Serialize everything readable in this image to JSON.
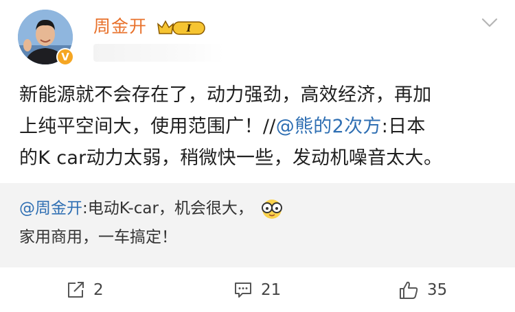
{
  "post": {
    "author": {
      "name": "周金开",
      "verified_mark": "V",
      "vip_level": "I"
    },
    "text_lines": [
      {
        "before": "新能源就不会存在了，动力强劲，高效经济，再加",
        "mention": "",
        "after": ""
      },
      {
        "before": "上纯平空间大，使用范围广！//",
        "mention": "@熊的2次方",
        "after": ":日本"
      },
      {
        "before": "的K car动力太弱，稍微快一些，发动机噪音太大。",
        "mention": "",
        "after": ""
      }
    ]
  },
  "retweet": {
    "mention": "@周金开",
    "line1": ":电动K-car，机会很大，",
    "line2": "家用商用，一车搞定！",
    "emoji": "glasses-emoji"
  },
  "actions": {
    "share": {
      "icon": "share-icon",
      "count": "2"
    },
    "comment": {
      "icon": "comment-icon",
      "count": "21"
    },
    "like": {
      "icon": "thumbs-up-icon",
      "count": "35"
    }
  },
  "colors": {
    "username": "#e8712b",
    "mention": "#2f6fb3",
    "retweet_bg": "#f3f3f3"
  }
}
